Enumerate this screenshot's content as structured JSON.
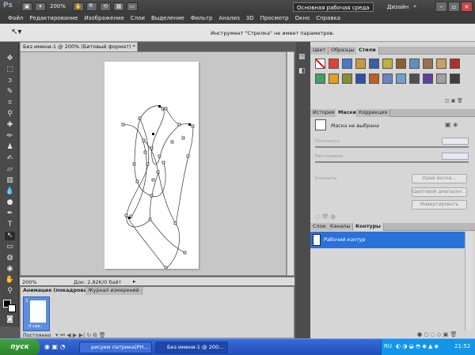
{
  "appbar": {
    "logo": "Ps",
    "zoom": "200%",
    "workspace_main": "Основная рабочая среда",
    "workspace_design": "Дизайн",
    "window_minimize": "–",
    "window_restore": "▫",
    "window_close": "×"
  },
  "menu": [
    "Файл",
    "Редактирование",
    "Изображение",
    "Слои",
    "Выделение",
    "Фильтр",
    "Анализ",
    "3D",
    "Просмотр",
    "Окно",
    "Справка"
  ],
  "options": {
    "message": "Инструмент \"Стрелка\" не имеет параметров."
  },
  "document": {
    "tab_title": "Без имени-1 @ 200% (Битовый формат) *",
    "status_zoom": "200%",
    "status_doc": "Док: 2,82K/0 байт"
  },
  "animation": {
    "tab_active": "Анимация (покадровая)",
    "tab_other": "Журнал измерений",
    "frame_number": "1",
    "frame_time": "0 сек.",
    "loop": "Постоянно"
  },
  "styles_panel": {
    "tabs": [
      "Цвет",
      "Образцы",
      "Стили"
    ],
    "swatch_colors": [
      "#ffffff",
      "#e0403a",
      "#4a78c8",
      "#c89a40",
      "#3a5fa8",
      "#c0b040",
      "#8a6030",
      "#6090c0",
      "#9a7050",
      "#c8a060",
      "#b03030",
      "#40a060",
      "#e0a020",
      "#8a8a30",
      "#3050a0",
      "#c06020",
      "#7080c0",
      "#70a0d0",
      "#505050",
      "#6040a0",
      "#a0a0a0",
      "#404040"
    ]
  },
  "masks_panel": {
    "tabs": [
      "История",
      "Маски",
      "Коррекция"
    ],
    "mask_label": "Маска не выбрана",
    "density_label": "Плотность:",
    "feather_label": "Растушевка:",
    "refine_label": "Уточнить:",
    "btn_edge": "Край маски...",
    "btn_color_range": "Цветовой диапазон...",
    "btn_invert": "Инвертировать"
  },
  "paths_panel": {
    "tabs": [
      "Слои",
      "Каналы",
      "Контуры"
    ],
    "path_name": "Рабочий контур"
  },
  "taskbar": {
    "start": "пуск",
    "tasks": [
      "рисуем патрика(PH...",
      "Без имени-1 @ 200..."
    ],
    "lang": "RU",
    "clock": "21:52"
  }
}
